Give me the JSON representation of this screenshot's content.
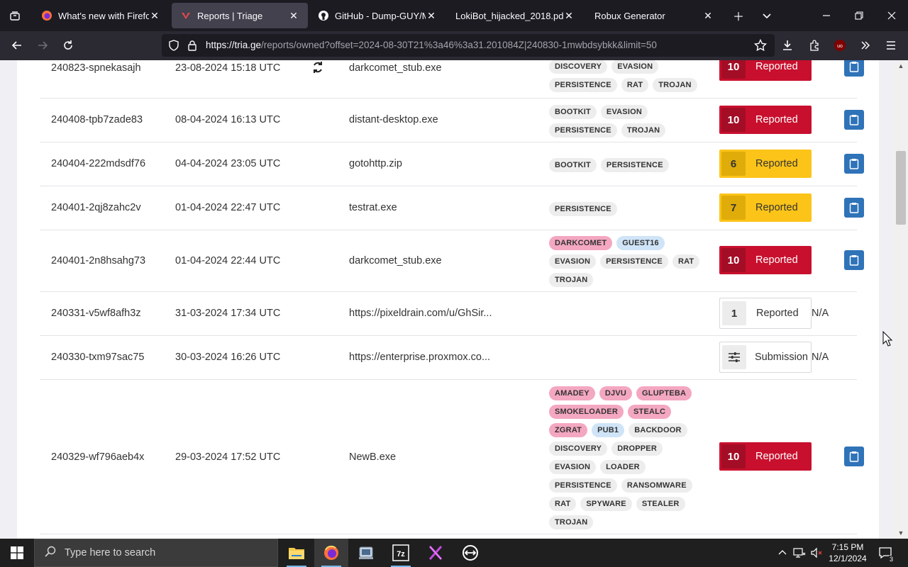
{
  "browser": {
    "tabs": [
      {
        "title": "What's new with Firefox",
        "active": false
      },
      {
        "title": "Reports | Triage",
        "active": true
      },
      {
        "title": "GitHub - Dump-GUY/Mal",
        "active": false
      },
      {
        "title": "LokiBot_hijacked_2018.pdf",
        "active": false
      },
      {
        "title": "Robux Generator",
        "active": false
      }
    ],
    "url_host": "https://tria.ge",
    "url_path": "/reports/owned?offset=2024-08-30T21%3a46%3a31.201084Z|240830-1mwbdsybkk&limit=50"
  },
  "reports": [
    {
      "id": "240823-spnekasajh",
      "date": "23-08-2024 15:18 UTC",
      "target": "darkcomet_stub.exe",
      "tags": [
        {
          "t": "DISCOVERY",
          "c": "grey"
        },
        {
          "t": "EVASION",
          "c": "grey"
        },
        {
          "t": "PERSISTENCE",
          "c": "grey"
        },
        {
          "t": "RAT",
          "c": "grey"
        },
        {
          "t": "TROJAN",
          "c": "grey"
        }
      ],
      "score": "10",
      "status": "Reported",
      "level": "red",
      "action": "clipboard"
    },
    {
      "id": "240408-tpb7zade83",
      "date": "08-04-2024 16:13 UTC",
      "target": "distant-desktop.exe",
      "tags": [
        {
          "t": "BOOTKIT",
          "c": "grey"
        },
        {
          "t": "EVASION",
          "c": "grey"
        },
        {
          "t": "PERSISTENCE",
          "c": "grey"
        },
        {
          "t": "TROJAN",
          "c": "grey"
        }
      ],
      "score": "10",
      "status": "Reported",
      "level": "red",
      "action": "clipboard"
    },
    {
      "id": "240404-222mdsdf76",
      "date": "04-04-2024 23:05 UTC",
      "target": "gotohttp.zip",
      "tags": [
        {
          "t": "BOOTKIT",
          "c": "grey"
        },
        {
          "t": "PERSISTENCE",
          "c": "grey"
        }
      ],
      "score": "6",
      "status": "Reported",
      "level": "yellow",
      "action": "clipboard"
    },
    {
      "id": "240401-2qj8zahc2v",
      "date": "01-04-2024 22:47 UTC",
      "target": "testrat.exe",
      "tags": [
        {
          "t": "PERSISTENCE",
          "c": "grey"
        }
      ],
      "score": "7",
      "status": "Reported",
      "level": "yellow",
      "action": "clipboard"
    },
    {
      "id": "240401-2n8hsahg73",
      "date": "01-04-2024 22:44 UTC",
      "target": "darkcomet_stub.exe",
      "tags": [
        {
          "t": "DARKCOMET",
          "c": "pink"
        },
        {
          "t": "GUEST16",
          "c": "blue"
        },
        {
          "t": "EVASION",
          "c": "grey"
        },
        {
          "t": "PERSISTENCE",
          "c": "grey"
        },
        {
          "t": "RAT",
          "c": "grey"
        },
        {
          "t": "TROJAN",
          "c": "grey"
        }
      ],
      "score": "10",
      "status": "Reported",
      "level": "red",
      "action": "clipboard"
    },
    {
      "id": "240331-v5wf8afh3z",
      "date": "31-03-2024 17:34 UTC",
      "target": "https://pixeldrain.com/u/GhSir...",
      "tags": [],
      "score": "1",
      "status": "Reported",
      "level": "white",
      "action": "N/A"
    },
    {
      "id": "240330-txm97sac75",
      "date": "30-03-2024 16:26 UTC",
      "target": "https://enterprise.proxmox.co...",
      "tags": [],
      "score": "",
      "status": "Submission",
      "level": "white",
      "action": "N/A"
    },
    {
      "id": "240329-wf796aeb4x",
      "date": "29-03-2024 17:52 UTC",
      "target": "NewB.exe",
      "tags": [
        {
          "t": "AMADEY",
          "c": "pink"
        },
        {
          "t": "DJVU",
          "c": "pink"
        },
        {
          "t": "GLUPTEBA",
          "c": "pink"
        },
        {
          "t": "SMOKELOADER",
          "c": "pink"
        },
        {
          "t": "STEALC",
          "c": "pink"
        },
        {
          "t": "ZGRAT",
          "c": "pink"
        },
        {
          "t": "PUB1",
          "c": "blue"
        },
        {
          "t": "BACKDOOR",
          "c": "grey"
        },
        {
          "t": "DISCOVERY",
          "c": "grey"
        },
        {
          "t": "DROPPER",
          "c": "grey"
        },
        {
          "t": "EVASION",
          "c": "grey"
        },
        {
          "t": "LOADER",
          "c": "grey"
        },
        {
          "t": "PERSISTENCE",
          "c": "grey"
        },
        {
          "t": "RANSOMWARE",
          "c": "grey"
        },
        {
          "t": "RAT",
          "c": "grey"
        },
        {
          "t": "SPYWARE",
          "c": "grey"
        },
        {
          "t": "STEALER",
          "c": "grey"
        },
        {
          "t": "TROJAN",
          "c": "grey"
        }
      ],
      "score": "10",
      "status": "Reported",
      "level": "red",
      "action": "clipboard"
    }
  ],
  "taskbar": {
    "search_placeholder": "Type here to search",
    "time": "7:15 PM",
    "date": "12/1/2024",
    "notification_count": "3"
  }
}
